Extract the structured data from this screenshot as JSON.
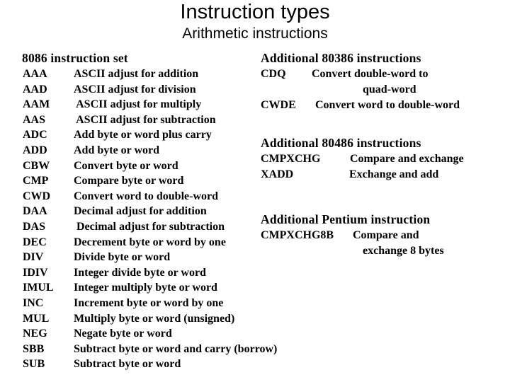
{
  "title": "Instruction types",
  "subtitle": "Arithmetic instructions",
  "left_section": {
    "heading": "8086 instruction set",
    "items": [
      {
        "mnemonic": "AAA",
        "description": "ASCII adjust for addition"
      },
      {
        "mnemonic": "AAD",
        "description": "ASCII adjust for division"
      },
      {
        "mnemonic": "AAM",
        "description": " ASCII adjust for multiply"
      },
      {
        "mnemonic": "AAS",
        "description": " ASCII adjust for subtraction"
      },
      {
        "mnemonic": "ADC",
        "description": "Add byte or word plus carry"
      },
      {
        "mnemonic": "ADD",
        "description": "Add byte or word"
      },
      {
        "mnemonic": "CBW",
        "description": "Convert byte or word"
      },
      {
        "mnemonic": "CMP",
        "description": "Compare byte or word"
      },
      {
        "mnemonic": "CWD",
        "description": "Convert word to double-word"
      },
      {
        "mnemonic": "DAA",
        "description": "Decimal adjust for addition"
      },
      {
        "mnemonic": "DAS",
        "description": " Decimal adjust for subtraction"
      },
      {
        "mnemonic": "DEC",
        "description": "Decrement byte or word by one"
      },
      {
        "mnemonic": "DIV",
        "description": "Divide byte or word"
      },
      {
        "mnemonic": "IDIV",
        "description": "Integer divide byte or word"
      },
      {
        "mnemonic": "IMUL",
        "description": "Integer multiply byte or word"
      },
      {
        "mnemonic": "INC",
        "description": "Increment byte or word by one"
      },
      {
        "mnemonic": "MUL",
        "description": "Multiply byte or word (unsigned)"
      },
      {
        "mnemonic": "NEG",
        "description": "Negate byte or word"
      },
      {
        "mnemonic": "SBB",
        "description": "Subtract byte or word and carry (borrow)"
      },
      {
        "mnemonic": "SUB",
        "description": "Subtract byte or word"
      }
    ]
  },
  "section_80386": {
    "heading": "Additional 80386 instructions",
    "items": [
      {
        "mnemonic": "CDQ",
        "description_line1": "Convert double-word to",
        "description_line2": "quad-word"
      },
      {
        "mnemonic": "CWDE",
        "description_line1": "Convert word to double-word"
      }
    ]
  },
  "section_80486": {
    "heading": "Additional 80486 instructions",
    "items": [
      {
        "mnemonic": "CMPXCHG",
        "description": "Compare and exchange"
      },
      {
        "mnemonic": "XADD",
        "description": "Exchange and add"
      }
    ]
  },
  "section_pentium": {
    "heading": "Additional Pentium instruction",
    "items": [
      {
        "mnemonic": "CMPXCHG8B",
        "description_line1": "Compare and",
        "description_line2": "exchange 8 bytes"
      }
    ]
  }
}
